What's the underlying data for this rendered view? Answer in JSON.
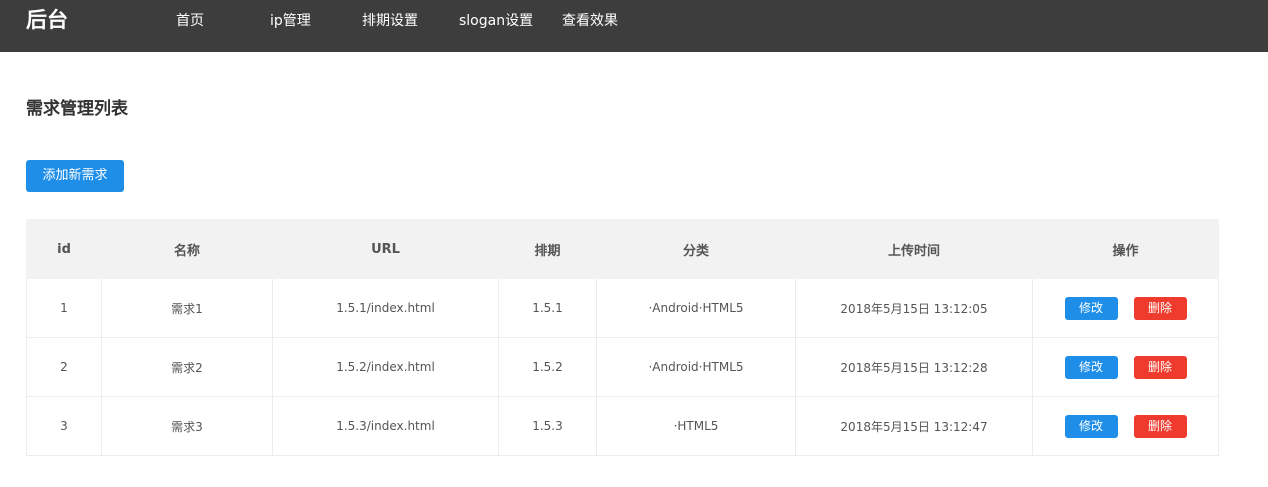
{
  "header": {
    "logo": "后台",
    "nav": [
      "首页",
      "ip管理",
      "排期设置",
      "slogan设置",
      "查看效果"
    ]
  },
  "page": {
    "title": "需求管理列表",
    "add_button": "添加新需求"
  },
  "table": {
    "columns": [
      "id",
      "名称",
      "URL",
      "排期",
      "分类",
      "上传时间",
      "操作"
    ],
    "rows": [
      [
        "1",
        "需求1",
        "1.5.1/index.html",
        "1.5.1",
        "·Android·HTML5",
        "2018年5月15日 13:12:05"
      ],
      [
        "2",
        "需求2",
        "1.5.2/index.html",
        "1.5.2",
        "·Android·HTML5",
        "2018年5月15日 13:12:28"
      ],
      [
        "3",
        "需求3",
        "1.5.3/index.html",
        "1.5.3",
        "·HTML5",
        "2018年5月15日 13:12:47"
      ]
    ],
    "actions": {
      "edit": "修改",
      "delete": "删除"
    }
  },
  "colors": {
    "topbar": "#3d3d3d",
    "primary": "#1e8ee9",
    "danger": "#ef3b2d",
    "header_bg": "#f2f2f2"
  }
}
